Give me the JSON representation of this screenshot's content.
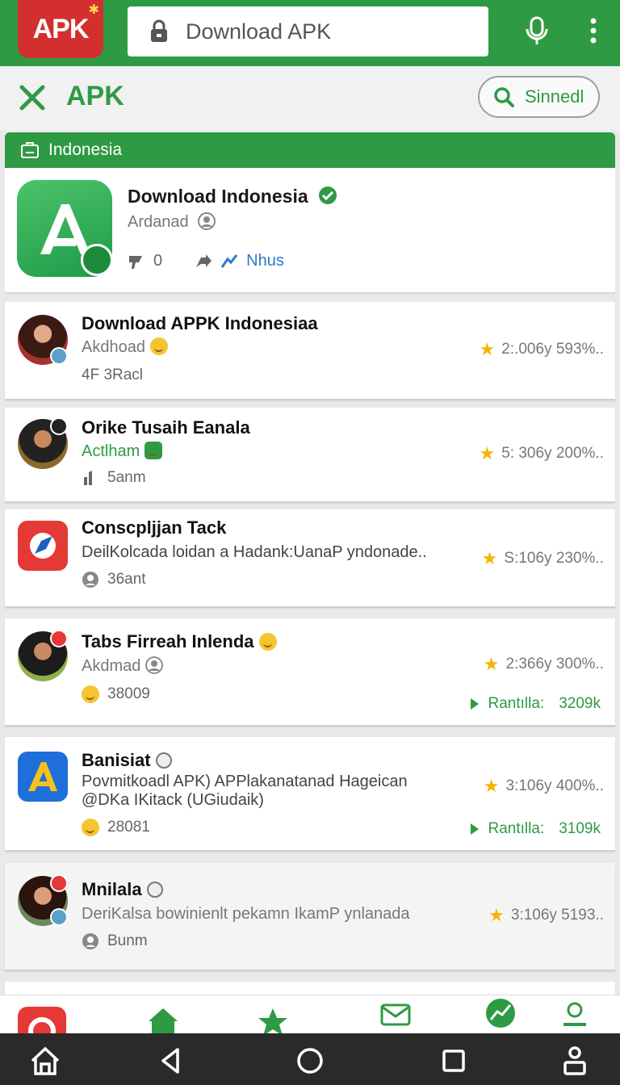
{
  "topbar": {
    "logo_text": "APK",
    "search_value": "Download APK",
    "mic_icon": "mic-icon",
    "menu_icon": "more-vert-icon",
    "brand_color": "#2f9a44",
    "logo_color": "#d32f2f"
  },
  "subbar": {
    "close_icon": "close-icon",
    "title": "APK",
    "search_button_label": "Sinnedl"
  },
  "category": {
    "label": "Indonesia"
  },
  "featured": {
    "title": "Download Indonesia",
    "developer": "Ardanad",
    "likes": "0",
    "tag": "Nhus"
  },
  "items": [
    {
      "title": "Download APPK Indonesiaa",
      "subtitle": "Akdhoad",
      "meta": "4F 3Racl",
      "rating": "2:.006y 593%.."
    },
    {
      "title": "Orike Tusaih Eanala",
      "subtitle": "Actlham",
      "meta": "5anm",
      "rating": "5: 306y 200%.."
    },
    {
      "title": "Conscpljjan Tack",
      "subtitle": "DeilKolcada loidan a Hadank:UanaP yndonade..",
      "meta": "36ant",
      "rating": "S:106y 230%.."
    },
    {
      "title": "Tabs Firreah Inlenda",
      "subtitle": "Akdmad",
      "meta": "38009",
      "rating": "2:366y 300%..",
      "install_label": "Rantılla:",
      "install_size": "3209k"
    },
    {
      "title": "Banisiat",
      "subtitle_line1": "Povmitkoadl APK) APPlakanatanad Hageican",
      "subtitle_line2": "@DKa IKitack (UGiudaik)",
      "meta": "28081",
      "rating": "3:106y 400%..",
      "install_label": "Rantılla:",
      "install_size": "3109k"
    },
    {
      "title": "Mnilala",
      "subtitle": "DeriKalsa bowinienlt pekamn IkamP ynlanada",
      "meta": "Bunm",
      "rating": "3:106y 5193.."
    }
  ],
  "app_nav": [
    "home-icon",
    "star-icon",
    "mail-icon",
    "trending-icon",
    "account-icon"
  ],
  "system_nav": [
    "home-icon",
    "back-icon",
    "circle-home-icon",
    "recents-icon",
    "accessibility-icon"
  ]
}
